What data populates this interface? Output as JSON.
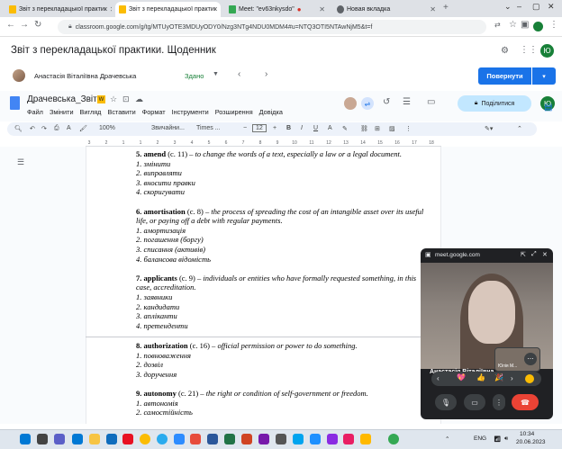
{
  "browser": {
    "tabs": [
      {
        "title": "Звіт з перекладацької практик",
        "active": false
      },
      {
        "title": "Звіт з перекладацької практик",
        "active": true
      },
      {
        "title": "Meet: \"ev63nkysdo\"",
        "active": false
      },
      {
        "title": "Новая вкладка",
        "active": false
      }
    ],
    "url": "classroom.google.com/g/tg/MTUyOTE3MDUyODY0/Nzg3NTg4NDU0MDM4#u=NTQ3OTI5NTAwNjM5&t=f"
  },
  "classroom": {
    "title": "Звіт з перекладацької практики. Щоденник",
    "student": "Анастасія Віталіївна Драчевська",
    "status": "Здано",
    "return_label": "Повернути",
    "profile_initial": "Ю"
  },
  "docs": {
    "title": "Драчевська_Звіт",
    "menu": [
      "Файл",
      "Змінити",
      "Вигляд",
      "Вставити",
      "Формат",
      "Інструменти",
      "Розширення",
      "Довідка"
    ],
    "share_label": "Поділитися",
    "toolbar": {
      "zoom": "100%",
      "style": "Звичайни...",
      "font": "Times ...",
      "size": "12"
    },
    "ruler": [
      "3",
      "2",
      "1",
      "1",
      "2",
      "3",
      "4",
      "5",
      "6",
      "7",
      "8",
      "9",
      "10",
      "11",
      "12",
      "13",
      "14",
      "15",
      "16",
      "17",
      "18"
    ]
  },
  "document": {
    "entries": [
      {
        "term": "5. amend",
        "ref": " (c. 11) – ",
        "def": "to change the words of a text, especially a law or a legal document.",
        "items": [
          "1. змінити",
          "2. виправляти",
          "3. вносити правки",
          "4. скоригувати"
        ]
      },
      {
        "term": "6. amortisation",
        "ref": " (c. 8) –  ",
        "def": "the process of spreading the cost of an intangible asset over its useful life, or paying off a debt with regular payments.",
        "items": [
          "1. амортизація",
          "2. погашення (боргу)",
          "3. списання (активів)",
          "4. балансова відомість"
        ]
      },
      {
        "term": "7. applicants",
        "ref": " (c. 9) – ",
        "def": "individuals or entities who have formally requested something, in this case, accreditation.",
        "items": [
          "1. заявники",
          "2. кандидати",
          "3. апліканти",
          "4. претенденти"
        ]
      },
      {
        "term": "8. authorization",
        "ref": " (c. 16) – ",
        "def": "official permission or power to do something.",
        "items": [
          "1. повноваження",
          "2. дозвіл",
          "3. доручення"
        ]
      },
      {
        "term": "9. autonomy",
        "ref": " (c. 21) –  ",
        "def": "the right or condition of self-government or freedom.",
        "items": [
          "1. автономія",
          "2. самостійність"
        ]
      }
    ]
  },
  "meet": {
    "host": "meet.google.com",
    "participant": "Анастасія Віталіївна",
    "thumb_label": "Юлія М..."
  },
  "taskbar": {
    "lang": "ENG",
    "time": "10:34",
    "date": "20.06.2023"
  }
}
